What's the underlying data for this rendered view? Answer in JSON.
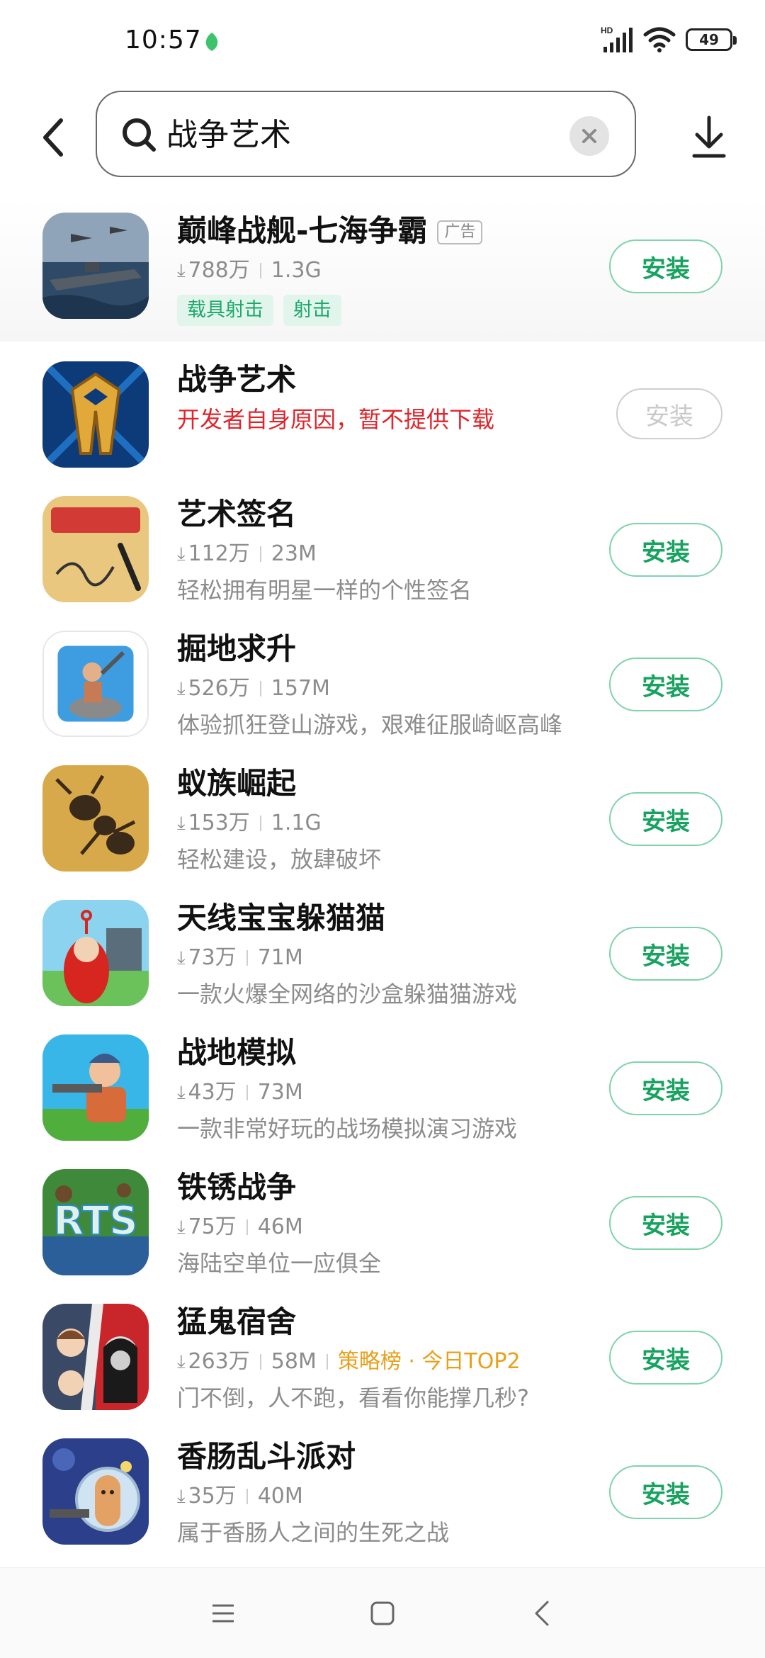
{
  "status_bar": {
    "time": "10:57",
    "network_label": "HD",
    "battery": "49"
  },
  "search": {
    "query": "战争艺术",
    "icons": [
      "back-arrow-icon",
      "search-icon",
      "clear-icon",
      "download-icon"
    ]
  },
  "apps": [
    {
      "name": "巅峰战舰-七海争霸",
      "ad_label": "广告",
      "downloads": "788万",
      "size": "1.3G",
      "tags": [
        "载具射击",
        "射击"
      ],
      "action": "安装"
    },
    {
      "name": "战争艺术",
      "notice": "开发者自身原因，暂不提供下载",
      "action": "安装",
      "action_disabled": true
    },
    {
      "name": "艺术签名",
      "downloads": "112万",
      "size": "23M",
      "desc": "轻松拥有明星一样的个性签名",
      "action": "安装"
    },
    {
      "name": "掘地求升",
      "downloads": "526万",
      "size": "157M",
      "desc": "体验抓狂登山游戏，艰难征服崎岖高峰",
      "action": "安装"
    },
    {
      "name": "蚁族崛起",
      "downloads": "153万",
      "size": "1.1G",
      "desc": "轻松建设，放肆破坏",
      "action": "安装"
    },
    {
      "name": "天线宝宝躲猫猫",
      "downloads": "73万",
      "size": "71M",
      "desc": "一款火爆全网络的沙盒躲猫猫游戏",
      "action": "安装"
    },
    {
      "name": "战地模拟",
      "downloads": "43万",
      "size": "73M",
      "desc": "一款非常好玩的战场模拟演习游戏",
      "action": "安装"
    },
    {
      "name": "铁锈战争",
      "downloads": "75万",
      "size": "46M",
      "desc": "海陆空单位一应俱全",
      "action": "安装",
      "icon_text": "RTS"
    },
    {
      "name": "猛鬼宿舍",
      "downloads": "263万",
      "size": "58M",
      "rank": "策略榜 · 今日TOP2",
      "desc": "门不倒，人不跑，看看你能撑几秒?",
      "action": "安装"
    },
    {
      "name": "香肠乱斗派对",
      "downloads": "35万",
      "size": "40M",
      "desc": "属于香肠人之间的生死之战",
      "action": "安装"
    }
  ],
  "nav_bar": {
    "icons": [
      "menu-icon",
      "home-icon",
      "back-icon"
    ]
  },
  "colors": {
    "accent_green": "#17a35f",
    "warning_red": "#e0242b",
    "rank_orange": "#e8a019"
  }
}
